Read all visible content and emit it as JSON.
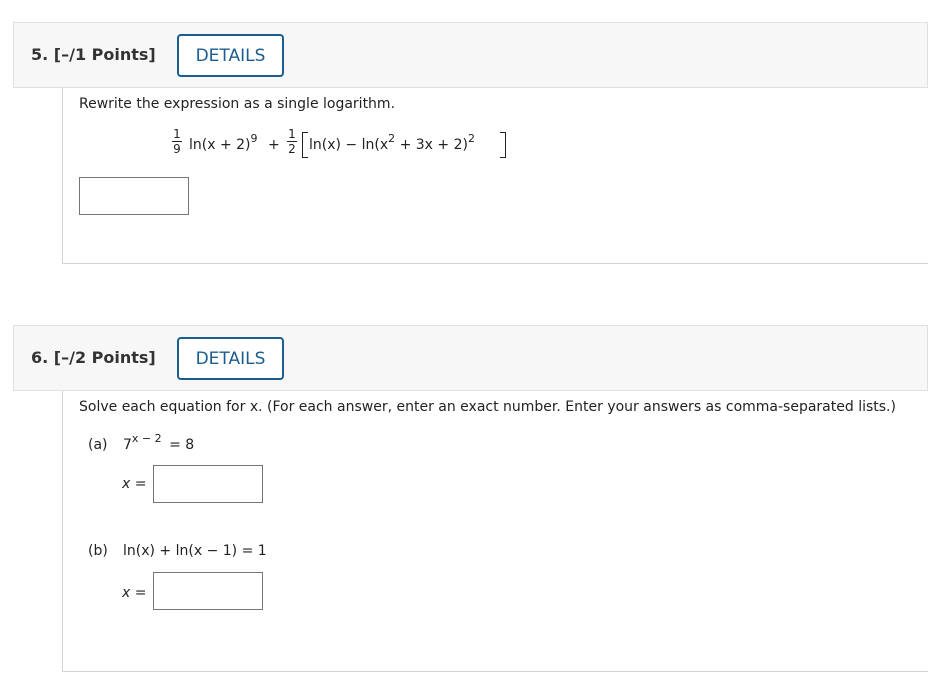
{
  "q5": {
    "number_label": "5. [–/1 Points]",
    "details_label": "DETAILS",
    "prompt": "Rewrite the expression as a single logarithm.",
    "expr": {
      "f1_num": "1",
      "f1_den": "9",
      "t1": "ln(x + 2)",
      "t1_exp": "9",
      "plus": "+",
      "f2_num": "1",
      "f2_den": "2",
      "t2a": "ln(x) − ln(x",
      "t2a_exp": "2",
      "t2b": " + 3x + 2)",
      "t2b_exp": "2"
    },
    "answer": {
      "value": "",
      "placeholder": ""
    }
  },
  "q6": {
    "number_label": "6. [–/2 Points]",
    "details_label": "DETAILS",
    "prompt": "Solve each equation for x. (For each answer, enter an exact number. Enter your answers as comma-separated lists.)",
    "part_a": {
      "label": "(a)",
      "base": "7",
      "exp": "x − 2",
      "rhs": "= 8",
      "var_label": "x =",
      "answer": {
        "value": "",
        "placeholder": ""
      }
    },
    "part_b": {
      "label": "(b)",
      "equation": "ln(x) + ln(x − 1) = 1",
      "var_label": "x =",
      "answer": {
        "value": "",
        "placeholder": ""
      }
    }
  },
  "colors": {
    "accent": "#1b5d8f",
    "header_bg": "#f7f7f7",
    "border": "#d4d4d4"
  }
}
